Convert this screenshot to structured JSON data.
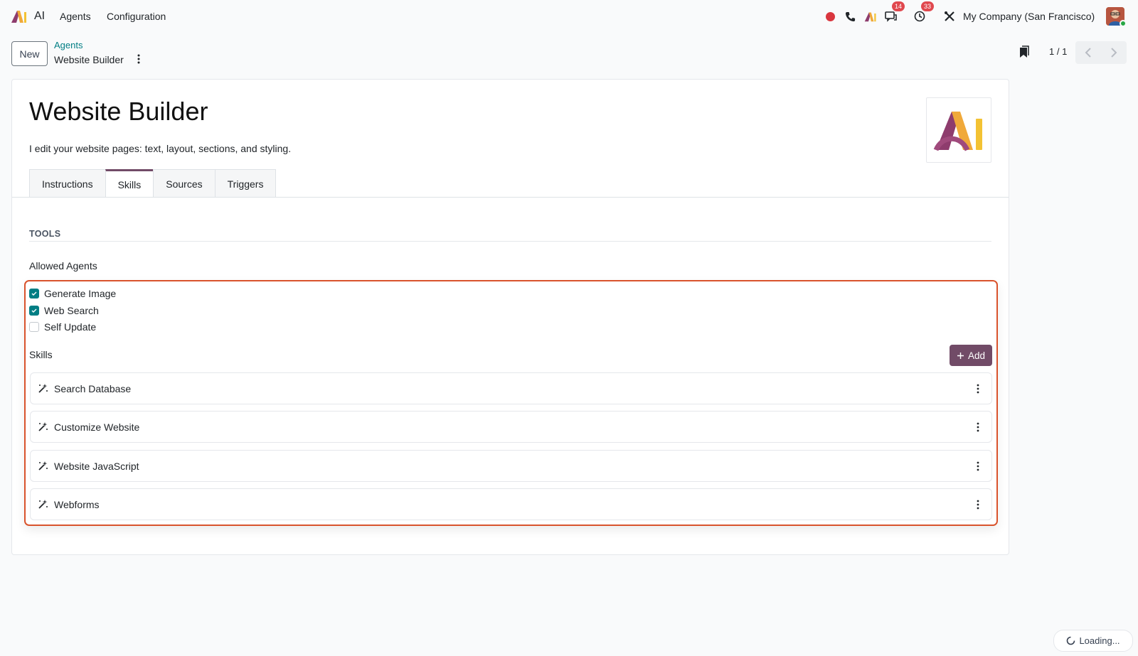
{
  "navbar": {
    "app_name": "AI",
    "menu": [
      "Agents",
      "Configuration"
    ],
    "messages_badge": "14",
    "activities_badge": "33",
    "company": "My Company (San Francisco)"
  },
  "control_panel": {
    "new_label": "New",
    "breadcrumb_parent": "Agents",
    "breadcrumb_current": "Website Builder",
    "pager": "1 / 1"
  },
  "form": {
    "title": "Website Builder",
    "description": "I edit your website pages: text, layout, sections, and styling.",
    "tabs": [
      {
        "label": "Instructions",
        "active": false
      },
      {
        "label": "Skills",
        "active": true
      },
      {
        "label": "Sources",
        "active": false
      },
      {
        "label": "Triggers",
        "active": false
      }
    ],
    "section_title": "TOOLS",
    "allowed_agents_label": "Allowed Agents",
    "allowed_agents": [
      {
        "label": "Generate Image",
        "checked": true
      },
      {
        "label": "Web Search",
        "checked": true
      },
      {
        "label": "Self Update",
        "checked": false
      }
    ],
    "skills_label": "Skills",
    "add_label": "Add",
    "skills": [
      "Search Database",
      "Customize Website",
      "Website JavaScript",
      "Webforms"
    ]
  },
  "status": {
    "loading_label": "Loading..."
  },
  "colors": {
    "brand": "#714b67",
    "teal": "#017e84",
    "highlight": "#d9532c"
  }
}
